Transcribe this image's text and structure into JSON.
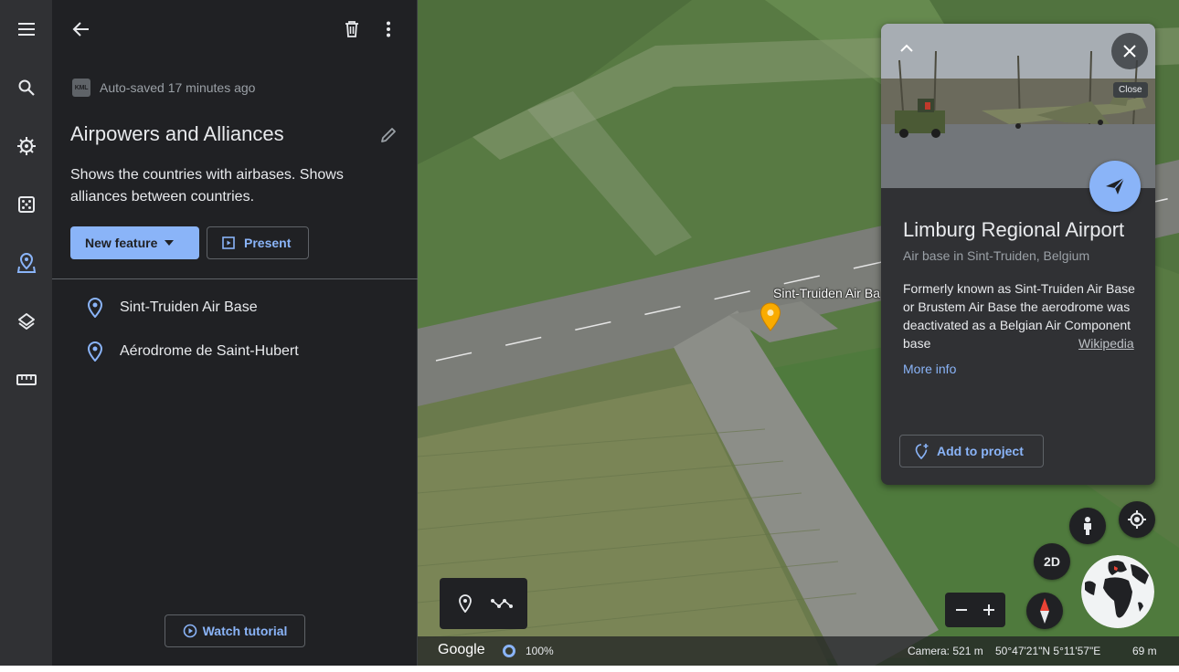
{
  "rail": {
    "items": [
      {
        "name": "menu-icon"
      },
      {
        "name": "search-icon"
      },
      {
        "name": "voyager-icon"
      },
      {
        "name": "feeling-lucky-icon"
      },
      {
        "name": "projects-icon",
        "active": true
      },
      {
        "name": "map-style-icon"
      },
      {
        "name": "measure-icon"
      }
    ]
  },
  "panel": {
    "autosave_badge": "KML",
    "autosave_text": "Auto-saved 17 minutes ago",
    "title": "Airpowers and Alliances",
    "description": "Shows the countries with airbases. Shows alliances between countries.",
    "new_feature_label": "New feature",
    "present_label": "Present",
    "features": [
      {
        "label": "Sint-Truiden Air Base"
      },
      {
        "label": "Aérodrome de Saint-Hubert"
      }
    ],
    "tutorial_label": "Watch tutorial"
  },
  "map": {
    "place_label": "Sint-Truiden Air Base",
    "pin_color": "#f9ab00"
  },
  "card": {
    "close_tooltip": "Close",
    "title": "Limburg Regional Airport",
    "subtitle": "Air base in Sint-Truiden, Belgium",
    "description": "Formerly known as Sint-Truiden Air Base or Brustem Air Base the aerodrome was deactivated as a Belgian Air Component base",
    "source_label": "Wikipedia",
    "more_info_label": "More info",
    "add_to_project_label": "Add to project"
  },
  "controls": {
    "view_mode_label": "2D"
  },
  "status": {
    "logo": "Google",
    "load_percent": "100%",
    "camera": "Camera: 521 m",
    "coordinates": "50°47'21\"N 5°11'57\"E",
    "scale": "69 m"
  },
  "colors": {
    "accent": "#8ab4f8",
    "panel_bg": "#202124",
    "rail_bg": "#303134",
    "card_bg": "#303134"
  }
}
